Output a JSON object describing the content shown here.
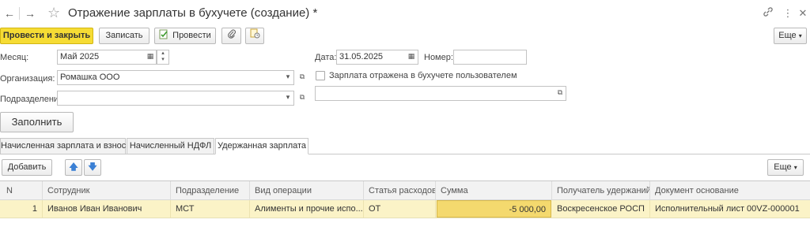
{
  "window": {
    "title": "Отражение зарплаты в бухучете (создание) *"
  },
  "toolbar": {
    "post_close": "Провести и закрыть",
    "save": "Записать",
    "post": "Провести",
    "more": "Еще"
  },
  "form": {
    "month_label": "Месяц:",
    "month_value": "Май 2025",
    "date_label": "Дата:",
    "date_value": "31.05.2025",
    "number_label": "Номер:",
    "number_value": "",
    "org_label": "Организация:",
    "org_value": "Ромашка ООО",
    "dept_label": "Подразделение:",
    "dept_value": "",
    "reflected_label": "Зарплата отражена в бухучете пользователем",
    "reflected_checked": false,
    "user_value": "",
    "fill_button": "Заполнить"
  },
  "tabs": [
    {
      "label": "Начисленная зарплата и взносы",
      "active": false
    },
    {
      "label": "Начисленный НДФЛ",
      "active": false
    },
    {
      "label": "Удержанная зарплата",
      "active": true
    }
  ],
  "table_toolbar": {
    "add": "Добавить",
    "more": "Еще"
  },
  "table": {
    "columns": [
      "N",
      "Сотрудник",
      "Подразделение",
      "Вид операции",
      "Статья расходов",
      "Сумма",
      "Получатель удержаний",
      "Документ основание"
    ],
    "rows": [
      [
        "1",
        "Иванов Иван Иванович",
        "МСТ",
        "Алименты и прочие испо...",
        "ОТ",
        "-5 000,00",
        "Воскресенское РОСП",
        "Исполнительный лист 00VZ-000001"
      ]
    ]
  },
  "colors": {
    "primary_button": "#f6dc34",
    "selected_row": "#fbf3c7",
    "selected_cell": "#f4d96e"
  }
}
